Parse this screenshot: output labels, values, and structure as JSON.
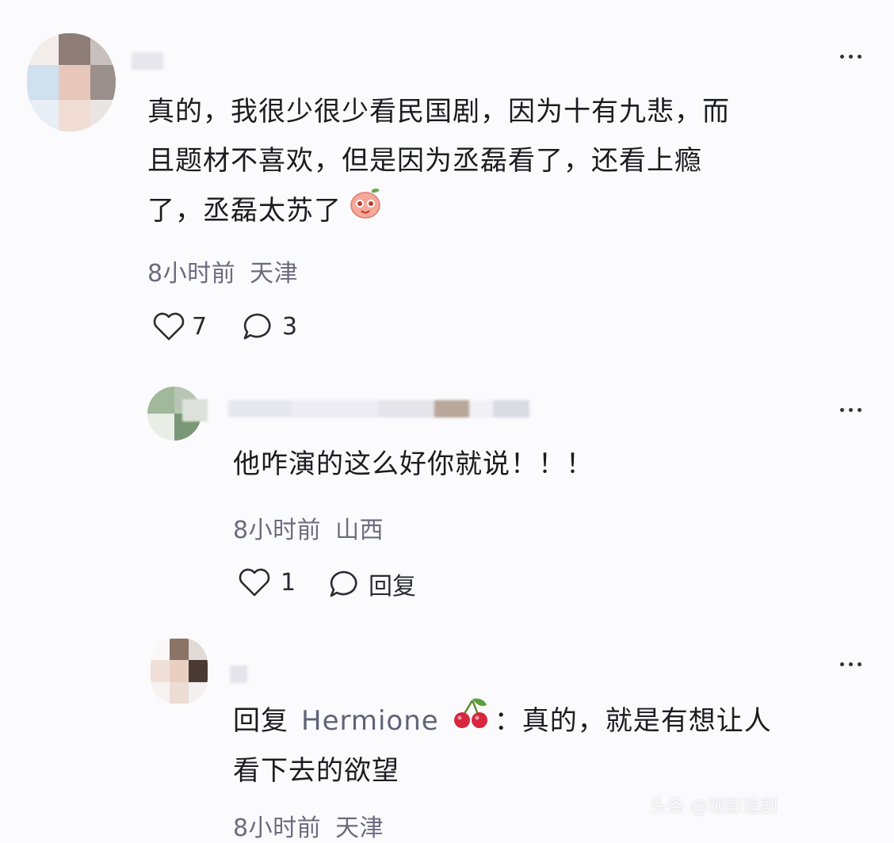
{
  "comments": [
    {
      "text_lines": [
        "真的，我很少很少看民国剧，因为十有九悲，而",
        "且题材不喜欢，但是因为丞磊看了，还看上瘾",
        "了，丞磊太苏了"
      ],
      "emoji": "peach-face-emoji",
      "time": "8小时前",
      "location": "天津",
      "likes": "7",
      "replies": "3"
    },
    {
      "text": "他咋演的这么好你就说！！！",
      "time": "8小时前",
      "location": "山西",
      "likes": "1",
      "reply_label": "回复"
    },
    {
      "reply_prefix": "回复",
      "reply_to": "Hermione",
      "reply_to_emoji": "cherry-emoji",
      "text_after": "：真的，就是有想让人",
      "text_line2": "看下去的欲望",
      "time_partial": "8小时前",
      "location_partial": "天津"
    }
  ],
  "watermark": "头条 @观影追剧"
}
